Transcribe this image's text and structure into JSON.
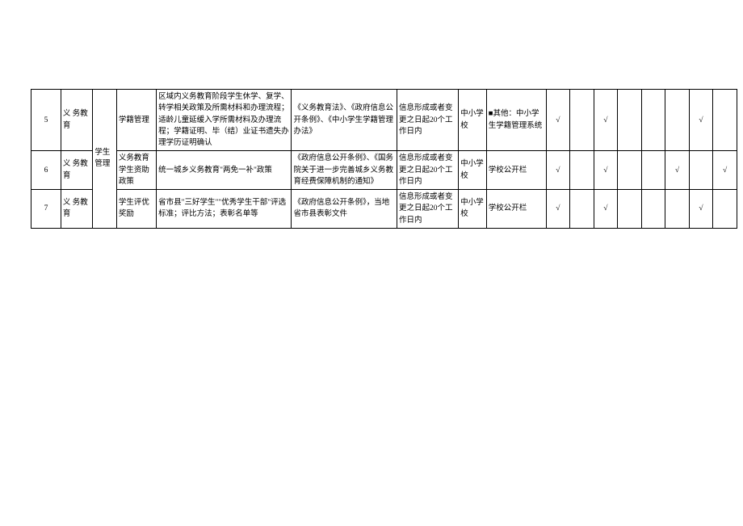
{
  "rows": [
    {
      "num": "5",
      "category": "义 务教育",
      "group": "学生管理",
      "item": "学籍管理",
      "content": "区域内义务教育阶段学生休学、复学、转学相关政策及所需材料和办理流程；适龄儿童延缓入学所需材料及办理流程；学籍证明、毕（结）业证书遗失办理学历证明确认",
      "basis": "《义务教育法》、《政府信息公开条例》、《中小学生学籍管理办法》",
      "timelimit": "信息形成或者变更之日起20个工作日内",
      "subject": "中小学校",
      "channel": "■其他：中小学生学籍管理系统",
      "flags": [
        "√",
        "",
        "√",
        "",
        "",
        "",
        "√",
        ""
      ]
    },
    {
      "num": "6",
      "category": "义 务教育",
      "item": "义务教育学生资助政策",
      "content": "统一城乡义务教育\"两免一补\"政策",
      "basis": "《政府信息公开条例》、《国务院关于进一步完善城乡义务教育经费保障机制的通知》",
      "timelimit": "信息形成或者变更之日起20个工作日内",
      "subject": "中小学校",
      "channel": "学校公开栏",
      "flags": [
        "√",
        "",
        "√",
        "",
        "",
        "√",
        "",
        "√"
      ]
    },
    {
      "num": "7",
      "category": "义 务教育",
      "item": "学生评优奖励",
      "content": "省市县\"三好学生\"\"优秀学生干部\"评选标准；评比方法；表彰名单等",
      "basis": "《政府信息公开条例》，当地省市县表彰文件",
      "timelimit": "信息形成或者变更之日起20个工作日内",
      "subject": "中小学校",
      "channel": "学校公开栏",
      "flags": [
        "√",
        "",
        "√",
        "",
        "",
        "",
        "√",
        ""
      ]
    }
  ]
}
